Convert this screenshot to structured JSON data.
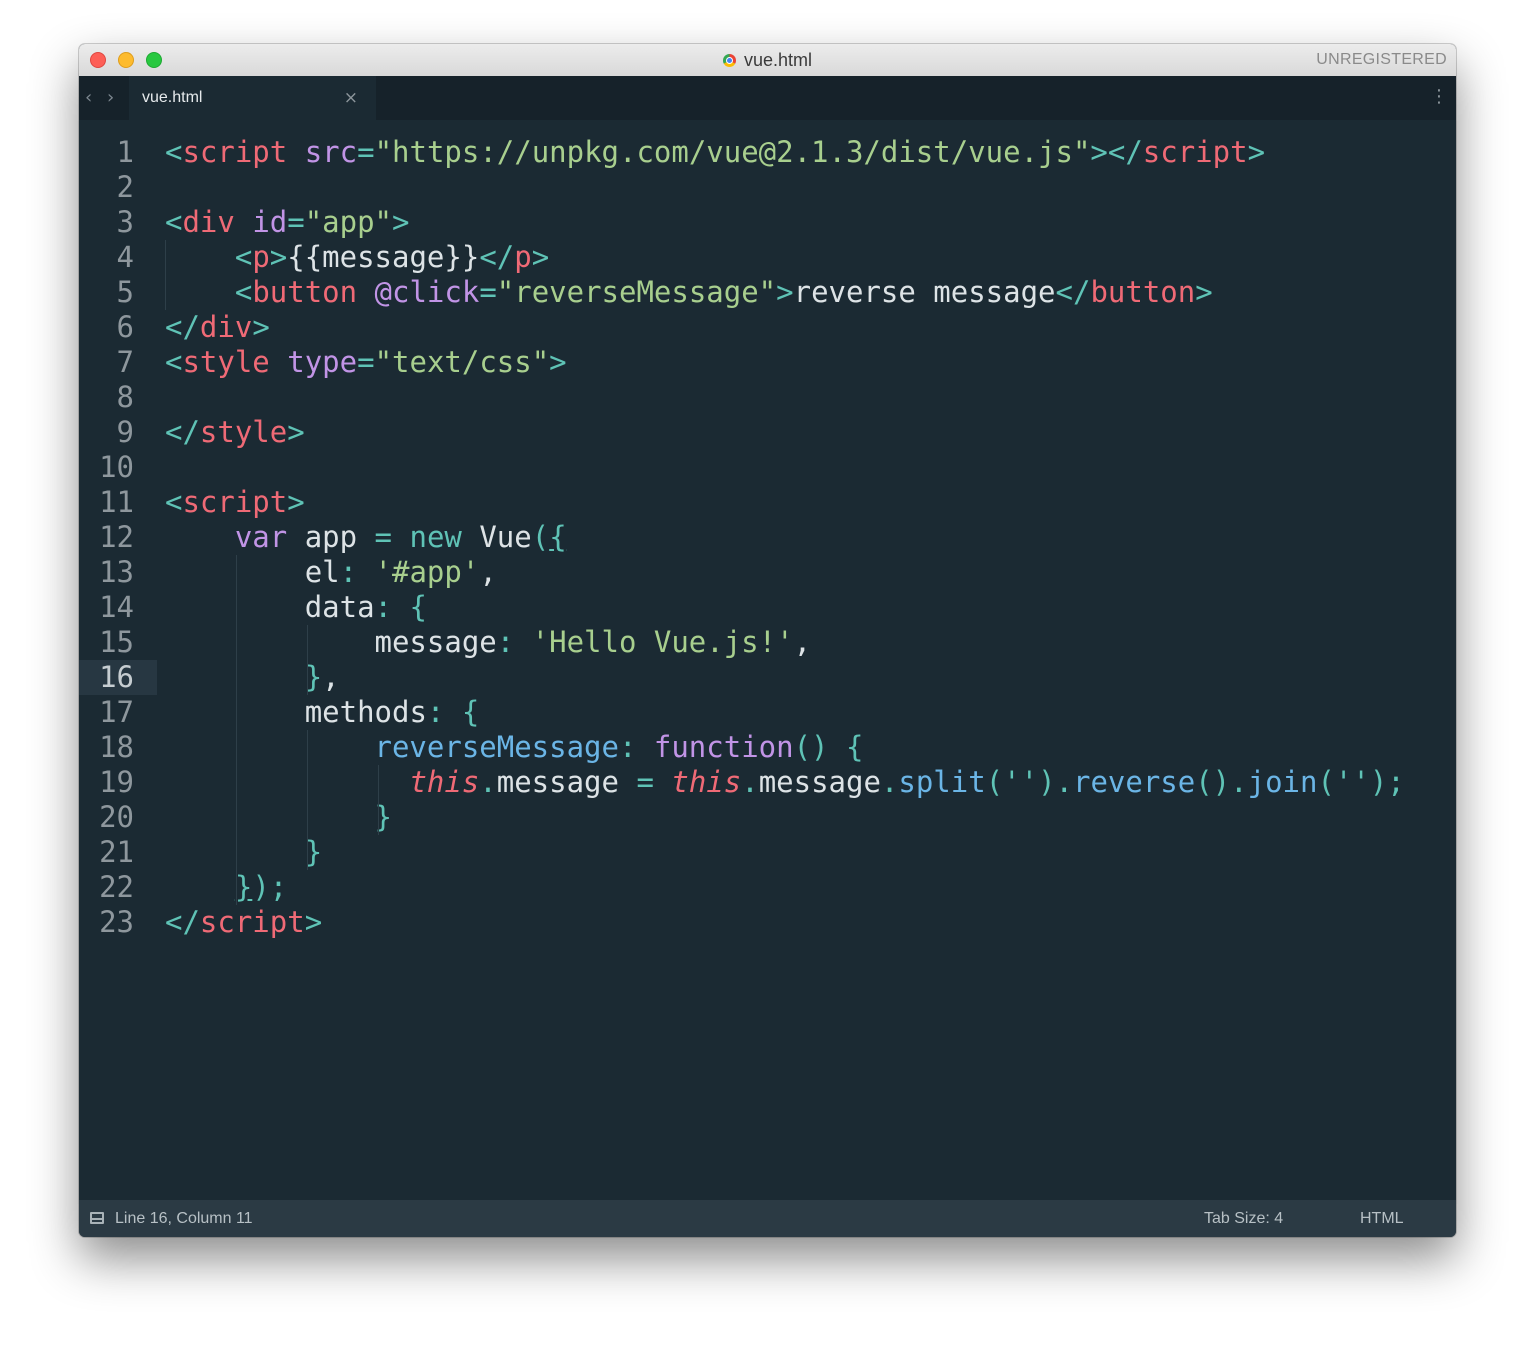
{
  "window": {
    "title": "vue.html",
    "license_status": "UNREGISTERED"
  },
  "tabs": [
    {
      "label": "vue.html",
      "active": true
    }
  ],
  "icons": {
    "close": "close-icon",
    "back": "chevron-left-icon",
    "forward": "chevron-right-icon",
    "menu": "kebab-menu-icon",
    "console": "panel-icon",
    "file": "chrome-file-icon"
  },
  "colors": {
    "background": "#1b2a33",
    "tag": "#ef6a76",
    "attribute": "#c194e6",
    "string": "#a8cf8e",
    "punctuation": "#5fc3b6",
    "function": "#6bb5e6",
    "plain": "#dde3e6"
  },
  "editor": {
    "current_line": 16,
    "lines": [
      {
        "n": "1",
        "tokens": [
          {
            "t": "<",
            "c": "p"
          },
          {
            "t": "script",
            "c": "tag"
          },
          {
            "t": " ",
            "c": "x"
          },
          {
            "t": "src",
            "c": "attr"
          },
          {
            "t": "=",
            "c": "p"
          },
          {
            "t": "\"https://unpkg.com/vue@2.1.3/dist/vue.js\"",
            "c": "str"
          },
          {
            "t": "></",
            "c": "p"
          },
          {
            "t": "script",
            "c": "tag"
          },
          {
            "t": ">",
            "c": "p"
          }
        ]
      },
      {
        "n": "2",
        "tokens": []
      },
      {
        "n": "3",
        "tokens": [
          {
            "t": "<",
            "c": "p"
          },
          {
            "t": "div",
            "c": "tag"
          },
          {
            "t": " ",
            "c": "x"
          },
          {
            "t": "id",
            "c": "attr"
          },
          {
            "t": "=",
            "c": "p"
          },
          {
            "t": "\"app\"",
            "c": "str"
          },
          {
            "t": ">",
            "c": "p"
          }
        ]
      },
      {
        "n": "4",
        "tokens": [
          {
            "t": "    ",
            "c": "x"
          },
          {
            "t": "<",
            "c": "p"
          },
          {
            "t": "p",
            "c": "tag"
          },
          {
            "t": ">",
            "c": "p"
          },
          {
            "t": "{{message}}",
            "c": "x"
          },
          {
            "t": "</",
            "c": "p"
          },
          {
            "t": "p",
            "c": "tag"
          },
          {
            "t": ">",
            "c": "p"
          }
        ]
      },
      {
        "n": "5",
        "tokens": [
          {
            "t": "    ",
            "c": "x"
          },
          {
            "t": "<",
            "c": "p"
          },
          {
            "t": "button",
            "c": "tag"
          },
          {
            "t": " ",
            "c": "x"
          },
          {
            "t": "@click",
            "c": "attr"
          },
          {
            "t": "=",
            "c": "p"
          },
          {
            "t": "\"reverseMessage\"",
            "c": "str"
          },
          {
            "t": ">",
            "c": "p"
          },
          {
            "t": "reverse message",
            "c": "x"
          },
          {
            "t": "</",
            "c": "p"
          },
          {
            "t": "button",
            "c": "tag"
          },
          {
            "t": ">",
            "c": "p"
          }
        ]
      },
      {
        "n": "6",
        "tokens": [
          {
            "t": "</",
            "c": "p"
          },
          {
            "t": "div",
            "c": "tag"
          },
          {
            "t": ">",
            "c": "p"
          }
        ]
      },
      {
        "n": "7",
        "tokens": [
          {
            "t": "<",
            "c": "p"
          },
          {
            "t": "style",
            "c": "tag"
          },
          {
            "t": " ",
            "c": "x"
          },
          {
            "t": "type",
            "c": "attr"
          },
          {
            "t": "=",
            "c": "p"
          },
          {
            "t": "\"text/css\"",
            "c": "str"
          },
          {
            "t": ">",
            "c": "p"
          }
        ]
      },
      {
        "n": "8",
        "tokens": []
      },
      {
        "n": "9",
        "tokens": [
          {
            "t": "</",
            "c": "p"
          },
          {
            "t": "style",
            "c": "tag"
          },
          {
            "t": ">",
            "c": "p"
          }
        ]
      },
      {
        "n": "10",
        "tokens": []
      },
      {
        "n": "11",
        "tokens": [
          {
            "t": "<",
            "c": "p"
          },
          {
            "t": "script",
            "c": "tag"
          },
          {
            "t": ">",
            "c": "p"
          }
        ]
      },
      {
        "n": "12",
        "tokens": [
          {
            "t": "    ",
            "c": "x"
          },
          {
            "t": "var",
            "c": "attr"
          },
          {
            "t": " app ",
            "c": "x"
          },
          {
            "t": "=",
            "c": "p"
          },
          {
            "t": " ",
            "c": "x"
          },
          {
            "t": "new",
            "c": "p"
          },
          {
            "t": " Vue",
            "c": "x"
          },
          {
            "t": "(",
            "c": "p"
          },
          {
            "t": "{",
            "c": "bu"
          }
        ]
      },
      {
        "n": "13",
        "tokens": [
          {
            "t": "        ",
            "c": "x"
          },
          {
            "t": "el",
            "c": "x"
          },
          {
            "t": ":",
            "c": "p"
          },
          {
            "t": " ",
            "c": "x"
          },
          {
            "t": "'#app'",
            "c": "str"
          },
          {
            "t": ",",
            "c": "x"
          }
        ]
      },
      {
        "n": "14",
        "tokens": [
          {
            "t": "        ",
            "c": "x"
          },
          {
            "t": "data",
            "c": "x"
          },
          {
            "t": ":",
            "c": "p"
          },
          {
            "t": " ",
            "c": "x"
          },
          {
            "t": "{",
            "c": "p"
          }
        ]
      },
      {
        "n": "15",
        "tokens": [
          {
            "t": "            ",
            "c": "x"
          },
          {
            "t": "message",
            "c": "x"
          },
          {
            "t": ":",
            "c": "p"
          },
          {
            "t": " ",
            "c": "x"
          },
          {
            "t": "'Hello Vue.js!'",
            "c": "str"
          },
          {
            "t": ",",
            "c": "x"
          }
        ]
      },
      {
        "n": "16",
        "tokens": [
          {
            "t": "        ",
            "c": "x"
          },
          {
            "t": "}",
            "c": "p"
          },
          {
            "t": ",",
            "c": "x"
          }
        ]
      },
      {
        "n": "17",
        "tokens": [
          {
            "t": "        ",
            "c": "x"
          },
          {
            "t": "methods",
            "c": "x"
          },
          {
            "t": ":",
            "c": "p"
          },
          {
            "t": " ",
            "c": "x"
          },
          {
            "t": "{",
            "c": "p"
          }
        ]
      },
      {
        "n": "18",
        "tokens": [
          {
            "t": "            ",
            "c": "x"
          },
          {
            "t": "reverseMessage",
            "c": "fn"
          },
          {
            "t": ":",
            "c": "p"
          },
          {
            "t": " ",
            "c": "x"
          },
          {
            "t": "function",
            "c": "attr"
          },
          {
            "t": "()",
            "c": "p"
          },
          {
            "t": " ",
            "c": "x"
          },
          {
            "t": "{",
            "c": "p"
          }
        ]
      },
      {
        "n": "19",
        "tokens": [
          {
            "t": "              ",
            "c": "x"
          },
          {
            "t": "this",
            "c": "this"
          },
          {
            "t": ".",
            "c": "p"
          },
          {
            "t": "message ",
            "c": "x"
          },
          {
            "t": "=",
            "c": "p"
          },
          {
            "t": " ",
            "c": "x"
          },
          {
            "t": "this",
            "c": "this"
          },
          {
            "t": ".",
            "c": "p"
          },
          {
            "t": "message",
            "c": "x"
          },
          {
            "t": ".",
            "c": "p"
          },
          {
            "t": "split",
            "c": "fn"
          },
          {
            "t": "(''). ",
            "c": "p"
          },
          {
            "t": "reverse",
            "c": "fn"
          },
          {
            "t": "().",
            "c": "p"
          },
          {
            "t": "join",
            "c": "fn"
          },
          {
            "t": "('');",
            "c": "p"
          }
        ]
      },
      {
        "n": "20",
        "tokens": [
          {
            "t": "            ",
            "c": "x"
          },
          {
            "t": "}",
            "c": "p"
          }
        ]
      },
      {
        "n": "21",
        "tokens": [
          {
            "t": "        ",
            "c": "x"
          },
          {
            "t": "}",
            "c": "p"
          }
        ]
      },
      {
        "n": "22",
        "tokens": [
          {
            "t": "    ",
            "c": "x"
          },
          {
            "t": "}",
            "c": "bu"
          },
          {
            "t": ");",
            "c": "p"
          }
        ]
      },
      {
        "n": "23",
        "tokens": [
          {
            "t": "</",
            "c": "p"
          },
          {
            "t": "script",
            "c": "tag"
          },
          {
            "t": ">",
            "c": "p"
          }
        ]
      }
    ]
  },
  "statusbar": {
    "position": "Line 16, Column 11",
    "tab_size": "Tab Size: 4",
    "syntax": "HTML"
  }
}
